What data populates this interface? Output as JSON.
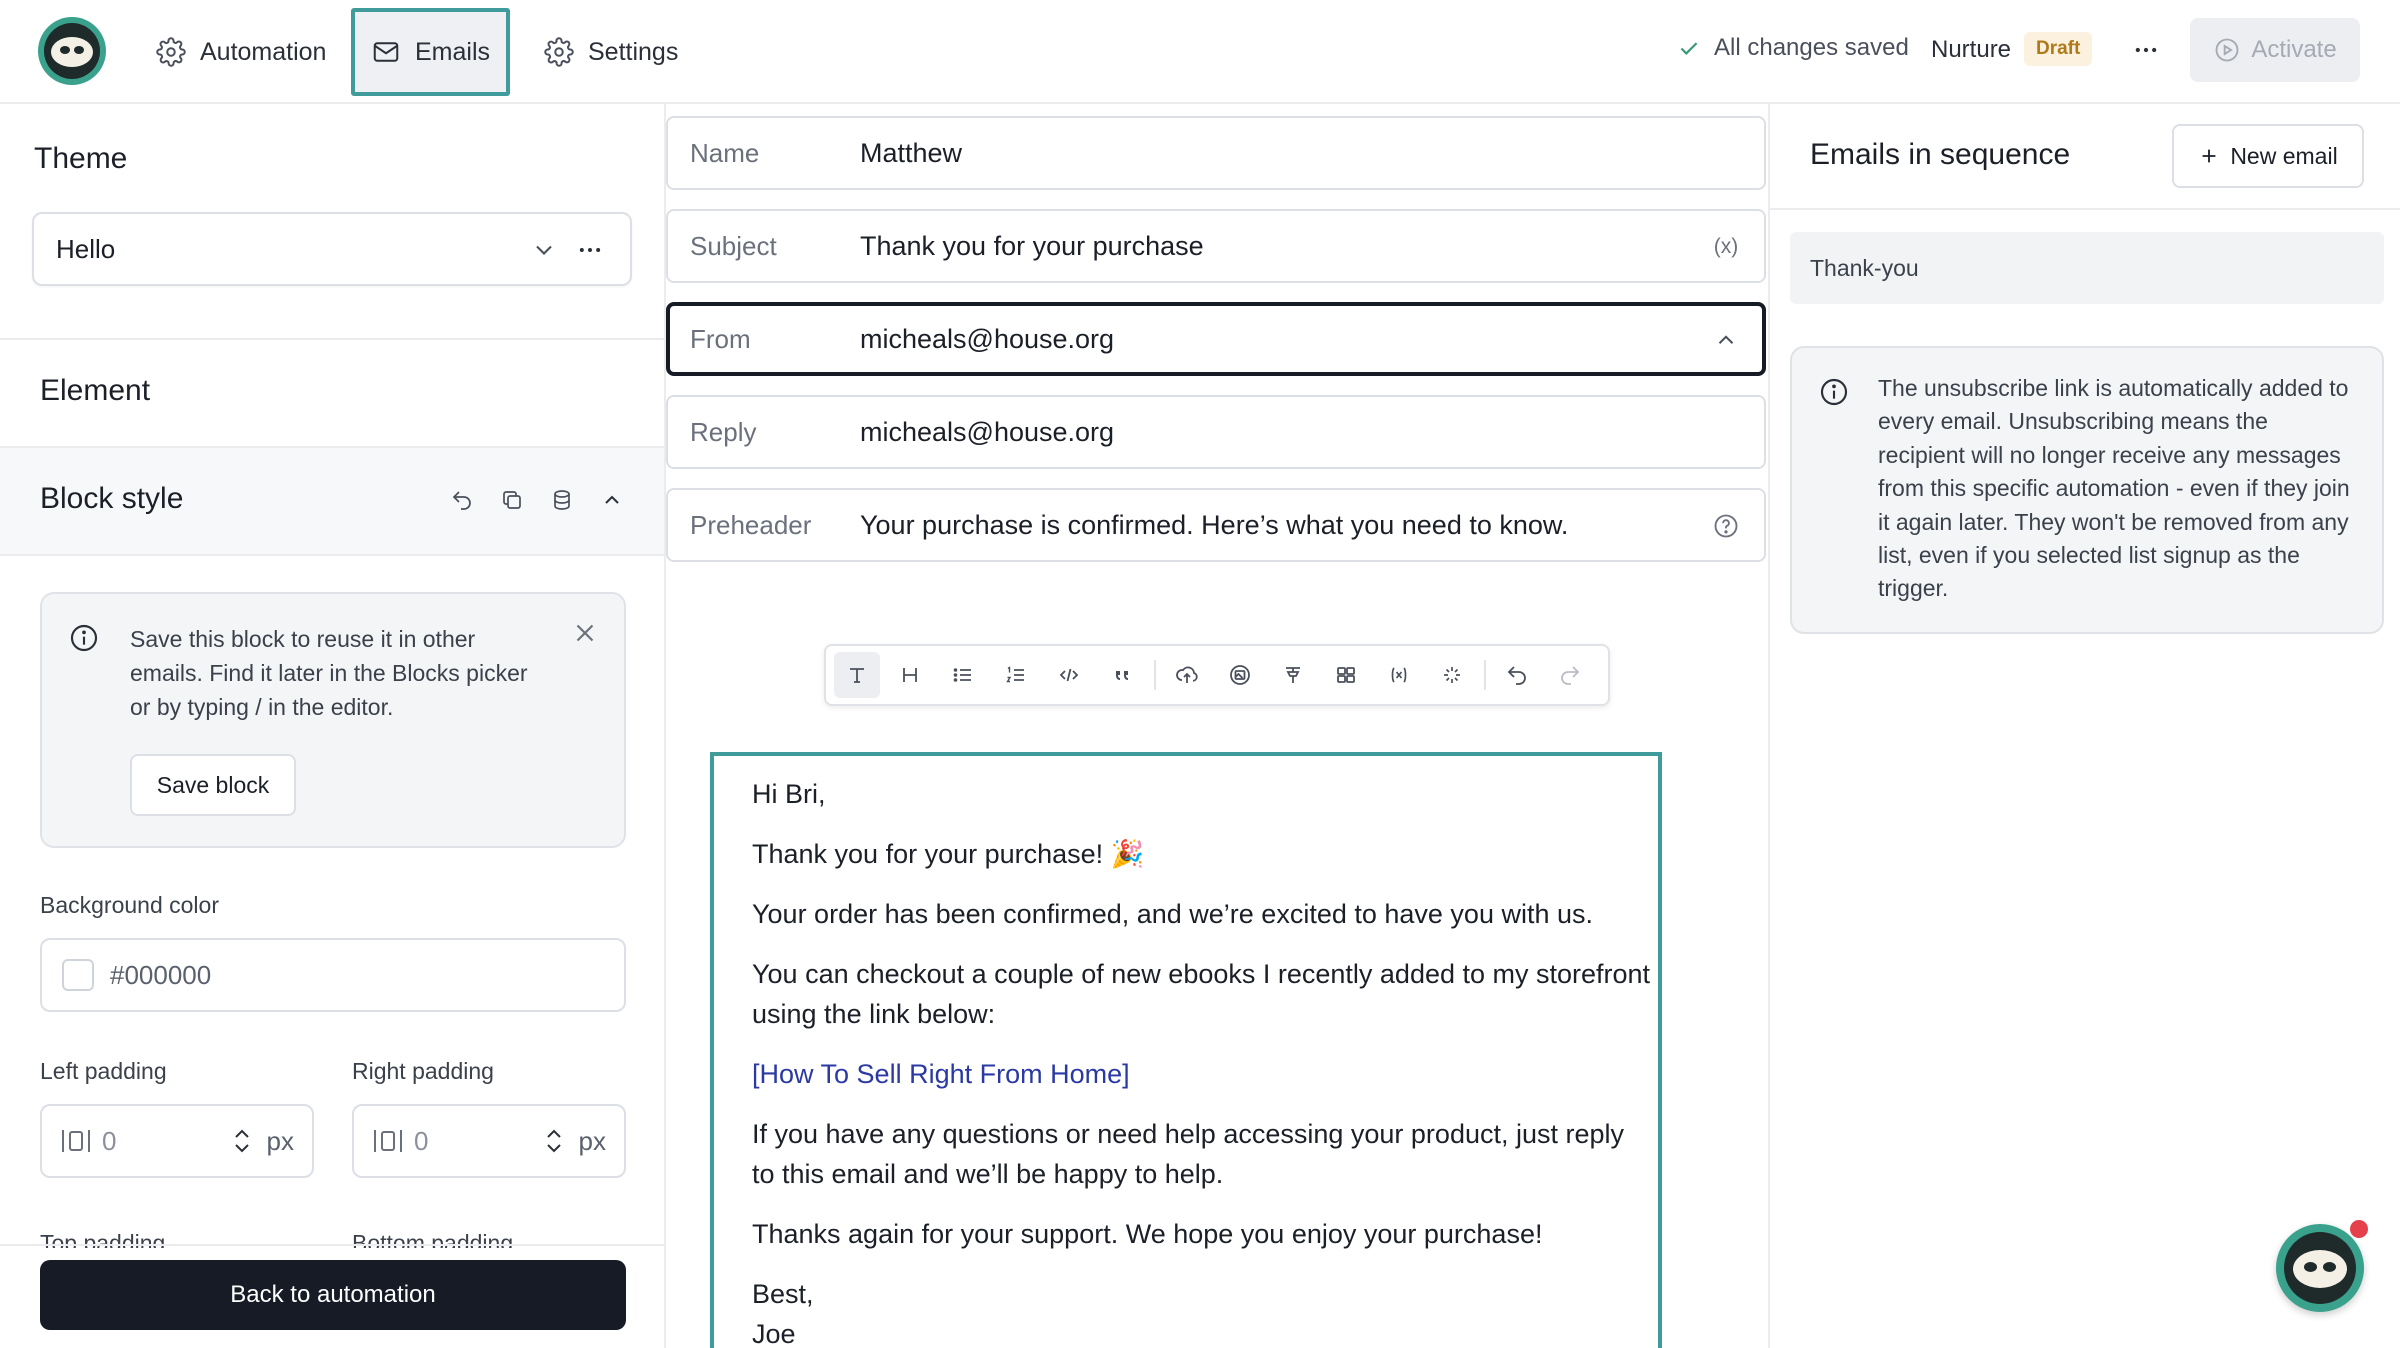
{
  "topbar": {
    "nav": [
      {
        "label": "Automation",
        "icon": "gear-icon"
      },
      {
        "label": "Emails",
        "icon": "mail-icon",
        "active": true
      },
      {
        "label": "Settings",
        "icon": "gear-icon"
      }
    ],
    "save_status": "All changes saved",
    "sequence_name": "Nurture",
    "status_badge": "Draft",
    "activate_label": "Activate"
  },
  "left": {
    "theme_title": "Theme",
    "theme_value": "Hello",
    "element_title": "Element",
    "block_style_title": "Block style",
    "save_hint": "Save this block to reuse it in other emails. Find it later in the Blocks picker or by typing / in the editor.",
    "save_block_label": "Save block",
    "bg_color_label": "Background color",
    "bg_color_value": "#000000",
    "left_padding_label": "Left padding",
    "right_padding_label": "Right padding",
    "left_padding_value": "0",
    "right_padding_value": "0",
    "unit": "px",
    "top_padding_label": "Top padding",
    "bottom_padding_label": "Bottom padding",
    "back_label": "Back to automation"
  },
  "email": {
    "fields": [
      {
        "label": "Name",
        "value": "Matthew"
      },
      {
        "label": "Subject",
        "value": "Thank you for your purchase",
        "trail": "(x)"
      },
      {
        "label": "From",
        "value": "micheals@house.org"
      },
      {
        "label": "Reply",
        "value": "micheals@house.org"
      },
      {
        "label": "Preheader",
        "value": "Your purchase is confirmed. Here’s what you need to know."
      }
    ],
    "body": {
      "greeting": "Hi Bri,",
      "thanks": "Thank you for your purchase! 🎉",
      "confirmed": "Your order has been confirmed, and we’re excited to have you with us.",
      "checkout": "You can checkout a couple of new ebooks I recently added to my storefront using the link below:",
      "link": "[How To Sell Right From Home]",
      "questions": "If you have any questions or need help accessing your product, just reply to this email and we’ll be happy to help.",
      "thanks_again": "Thanks again for your support. We hope you enjoy your purchase!",
      "signoff": "Best,",
      "signature": "Joe"
    }
  },
  "right": {
    "title": "Emails in sequence",
    "new_email_label": "New email",
    "emails": [
      "Thank-you"
    ],
    "unsubscribe_notice": "The unsubscribe link is automatically added to every email. Unsubscribing means the recipient will no longer receive any messages from this specific automation - even if they join it again later. They won't be removed from any list, even if you selected list signup as the trigger."
  },
  "colors": {
    "accent": "#3f9c9a",
    "primary_dark": "#161b26",
    "draft_text": "#b07a1a",
    "draft_bg": "#fbf1de",
    "link": "#2b3aa3",
    "notification": "#e5414d"
  }
}
